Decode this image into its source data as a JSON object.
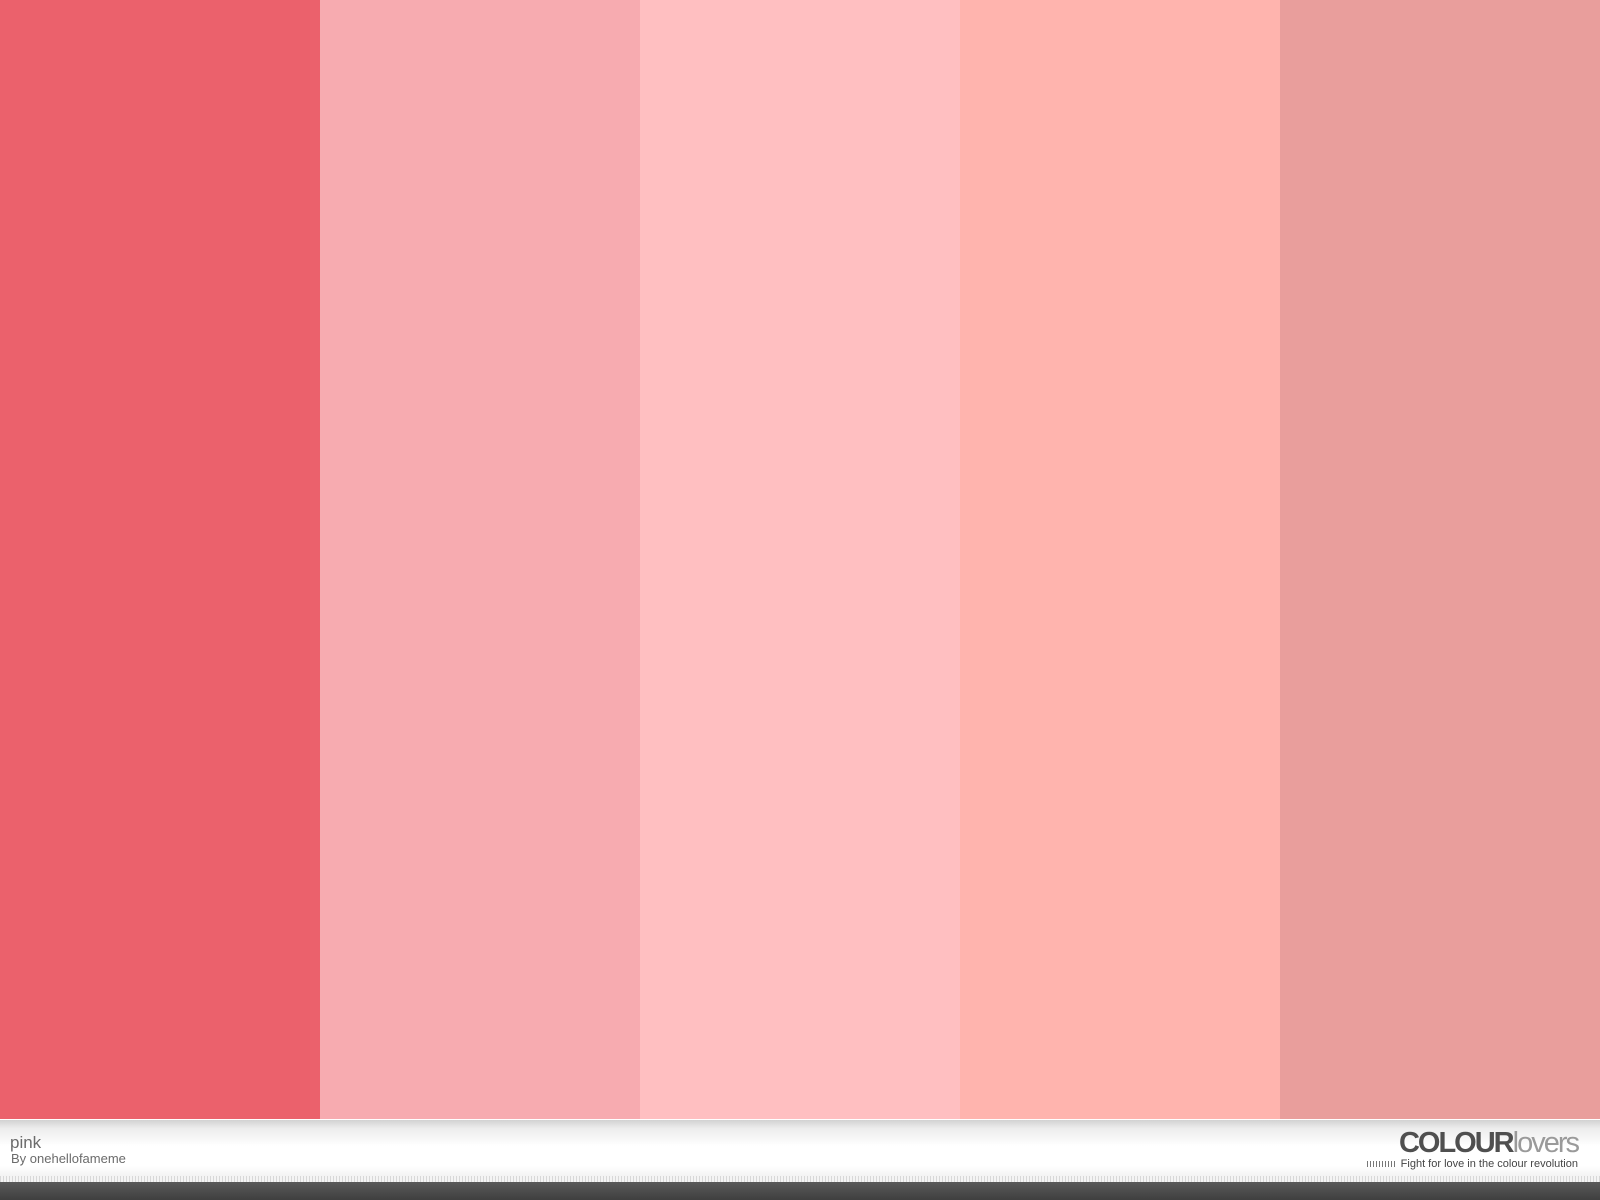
{
  "palette": {
    "title": "pink",
    "author": "By onehellofameme",
    "colors": [
      {
        "name": "color-1",
        "hex": "#EB616C"
      },
      {
        "name": "color-2",
        "hex": "#F7ABB0"
      },
      {
        "name": "color-3",
        "hex": "#FFBFC1"
      },
      {
        "name": "color-4",
        "hex": "#FFB4AE"
      },
      {
        "name": "color-5",
        "hex": "#E99E9C"
      }
    ]
  },
  "branding": {
    "logo_strong": "COLOUR",
    "logo_light": "lovers",
    "tagline": "Fight for love in the colour revolution"
  }
}
